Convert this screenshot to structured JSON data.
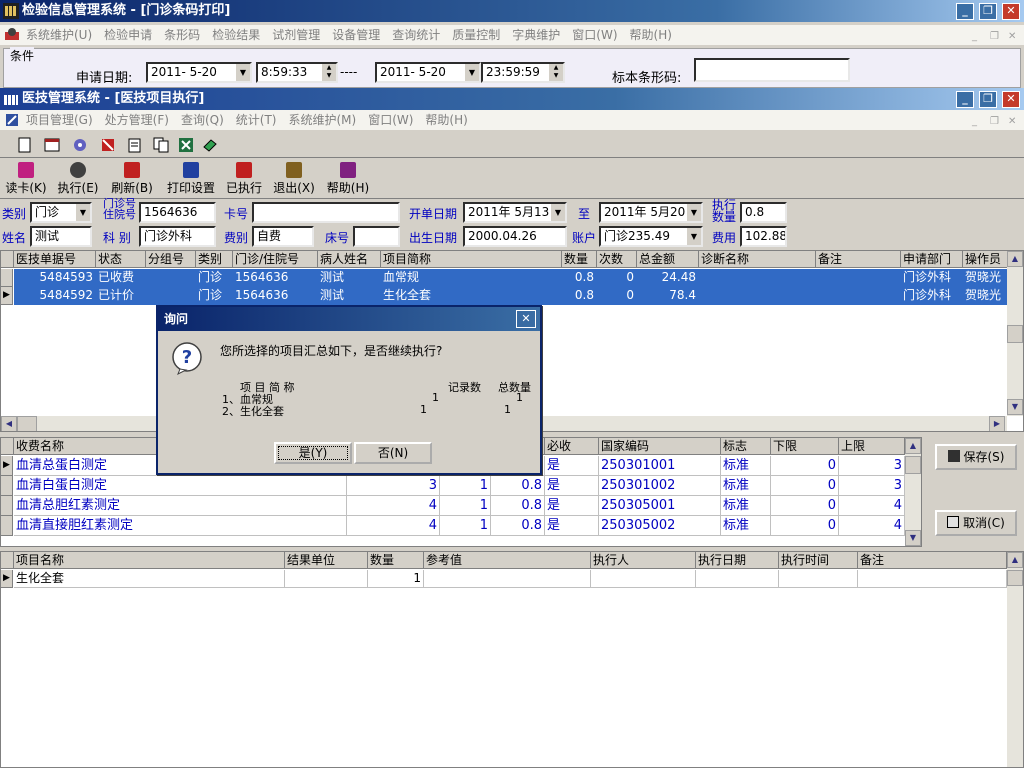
{
  "outer": {
    "title": "检验信息管理系统 - [门诊条码打印]",
    "menu": [
      "系统维护(U)",
      "检验申请",
      "条形码",
      "检验结果",
      "试剂管理",
      "设备管理",
      "查询统计",
      "质量控制",
      "字典维护",
      "窗口(W)",
      "帮助(H)"
    ],
    "condition_label": "条件",
    "apply_date_label": "申请日期:",
    "date_from": "2011- 5-20",
    "time_from": "8:59:33",
    "dash": "----",
    "date_to": "2011- 5-20",
    "time_to": "23:59:59",
    "barcode_label": "标本条形码:",
    "barcode_value": ""
  },
  "inner": {
    "title": "医技管理系统 - [医技项目执行]",
    "menu": [
      "项目管理(G)",
      "处方管理(F)",
      "查询(Q)",
      "统计(T)",
      "系统维护(M)",
      "窗口(W)",
      "帮助(H)"
    ],
    "toolbar": [
      {
        "label": "读卡(K)",
        "icon": "card-reader-icon"
      },
      {
        "label": "执行(E)",
        "icon": "execute-gear-icon"
      },
      {
        "label": "刷新(B)",
        "icon": "refresh-icon"
      },
      {
        "label": "打印设置",
        "icon": "print-setup-icon"
      },
      {
        "label": "已执行",
        "icon": "checkmark-icon"
      },
      {
        "label": "退出(X)",
        "icon": "exit-door-icon"
      },
      {
        "label": "帮助(H)",
        "icon": "help-book-icon"
      }
    ]
  },
  "form": {
    "category_label": "类别",
    "category_value": "门诊",
    "outpatient_label1": "门诊号",
    "outpatient_label2": "住院号",
    "outpatient_value": "1564636",
    "card_label": "卡号",
    "card_value": "",
    "bill_date_label": "开单日期",
    "bill_date_from": "2011年 5月13",
    "to_label": "至",
    "bill_date_to": "2011年 5月20",
    "exec_qty_label1": "执行",
    "exec_qty_label2": "数量",
    "exec_qty_value": "0.8",
    "name_label": "姓名",
    "name_value": "测试",
    "dept_label": "科 别",
    "dept_value": "门诊外科",
    "fee_type_label": "费别",
    "fee_type_value": "自费",
    "bed_label": "床号",
    "bed_value": "",
    "birth_label": "出生日期",
    "birth_value": "2000.04.26",
    "account_label": "账户",
    "account_value": "门诊235.49",
    "fee_label": "费用",
    "fee_value": "102.88"
  },
  "grid1": {
    "headers": [
      "医技单据号",
      "状态",
      "分组号",
      "类别",
      "门诊/住院号",
      "病人姓名",
      "项目简称",
      "数量",
      "次数",
      "总金额",
      "诊断名称",
      "备注",
      "申请部门",
      "操作员"
    ],
    "rows": [
      [
        "5484593",
        "已收费",
        "",
        "门诊",
        "1564636",
        "测试",
        "血常规",
        "0.8",
        "0",
        "24.48",
        "",
        "",
        "门诊外科",
        "贺晓光"
      ],
      [
        "5484592",
        "已计价",
        "",
        "门诊",
        "1564636",
        "测试",
        "生化全套",
        "0.8",
        "0",
        "78.4",
        "",
        "",
        "门诊外科",
        "贺晓光"
      ]
    ]
  },
  "grid2": {
    "headers": [
      "收费名称",
      "",
      "",
      "",
      "必收",
      "国家编码",
      "标志",
      "下限",
      "上限"
    ],
    "rows": [
      [
        "血清总蛋白测定",
        "",
        "",
        "",
        "是",
        "250301001",
        "标准",
        "0",
        "3"
      ],
      [
        "血清白蛋白测定",
        "3",
        "1",
        "0.8",
        "是",
        "250301002",
        "标准",
        "0",
        "3"
      ],
      [
        "血清总胆红素测定",
        "4",
        "1",
        "0.8",
        "是",
        "250305001",
        "标准",
        "0",
        "4"
      ],
      [
        "血清直接胆红素测定",
        "4",
        "1",
        "0.8",
        "是",
        "250305002",
        "标准",
        "0",
        "4"
      ]
    ],
    "save_label": "保存(S)",
    "cancel_label": "取消(C)"
  },
  "grid3": {
    "headers": [
      "项目名称",
      "结果单位",
      "数量",
      "参考值",
      "执行人",
      "执行日期",
      "执行时间",
      "备注"
    ],
    "rows": [
      [
        "生化全套",
        "",
        "1",
        "",
        "",
        "",
        "",
        ""
      ]
    ]
  },
  "dialog": {
    "title": "询问",
    "message": "您所选择的项目汇总如下，是否继续执行?",
    "col_name": "项  目  简  称",
    "col_count": "记录数",
    "col_total": "总数量",
    "items": [
      {
        "name": "1、血常规",
        "count": "1",
        "total": "1"
      },
      {
        "name": "2、生化全套",
        "count": "1",
        "total": "1"
      }
    ],
    "yes_label": "是(Y)",
    "no_label": "否(N)"
  },
  "colors": {
    "selection": "#316ac5",
    "title_dark": "#0a246a",
    "link_blue": "#0000c0"
  }
}
